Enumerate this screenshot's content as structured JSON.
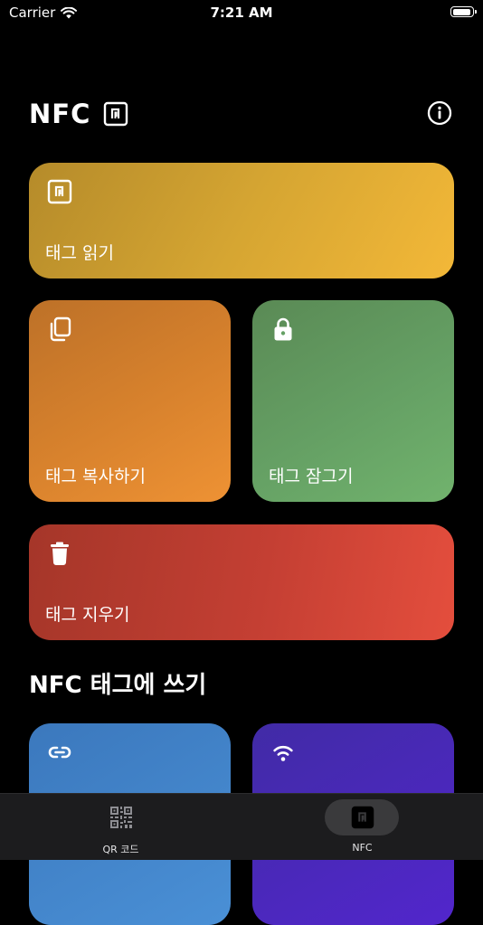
{
  "status_bar": {
    "carrier": "Carrier",
    "time": "7:21 AM",
    "battery_level": 0.95
  },
  "header": {
    "title": "NFC",
    "title_icon": "nfc-icon",
    "info_icon": "info-icon"
  },
  "actions": {
    "read": {
      "label": "태그 읽기",
      "icon": "nfc-icon",
      "color": "#f3b838"
    },
    "copy": {
      "label": "태그 복사하기",
      "icon": "copy-icon",
      "color": "#ee9234"
    },
    "lock": {
      "label": "태그 잠그기",
      "icon": "lock-icon",
      "color": "#71b36d"
    },
    "erase": {
      "label": "태그 지우기",
      "icon": "trash-icon",
      "color": "#e44e3d"
    }
  },
  "write_section": {
    "title": "NFC 태그에 쓰기",
    "cards": [
      {
        "icon": "link-icon",
        "color": "#4a90d6"
      },
      {
        "icon": "wifi-icon",
        "color": "#5226cc"
      }
    ]
  },
  "tab_bar": {
    "tabs": [
      {
        "label": "QR 코드",
        "icon": "qr-code-icon",
        "selected": false
      },
      {
        "label": "NFC",
        "icon": "nfc-icon",
        "selected": true
      }
    ]
  }
}
